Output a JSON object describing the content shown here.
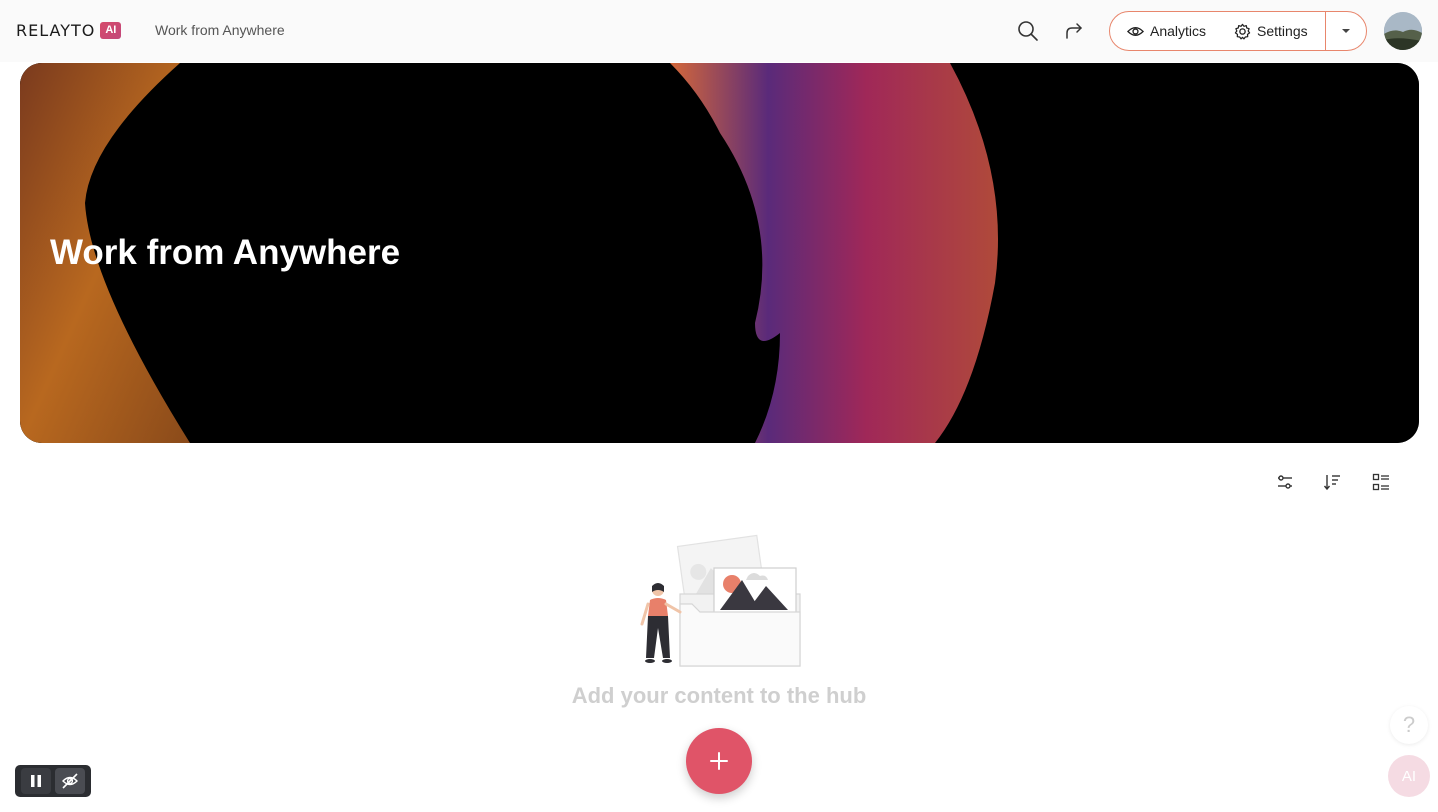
{
  "header": {
    "logo_text": "RELAYTO",
    "logo_badge": "AI",
    "hub_title": "Work from Anywhere",
    "search_icon": "search-icon",
    "share_icon": "share-icon",
    "analytics_label": "Analytics",
    "settings_label": "Settings",
    "dropdown_icon": "caret-down-icon",
    "avatar_icon": "user-avatar"
  },
  "banner": {
    "title": "Work from Anywhere"
  },
  "toolbar": {
    "filter_icon": "filter-sliders-icon",
    "sort_icon": "sort-icon",
    "view_icon": "list-view-icon"
  },
  "empty_state": {
    "message": "Add your content to the hub"
  },
  "fab": {
    "icon": "plus-icon"
  },
  "recording": {
    "pause_icon": "pause-icon",
    "hide_icon": "eye-off-icon"
  },
  "help": {
    "label": "?"
  },
  "ai_assistant": {
    "label": "AI"
  },
  "colors": {
    "accent": "#e05468",
    "outline": "#e8866c",
    "badge": "#c2487a"
  }
}
